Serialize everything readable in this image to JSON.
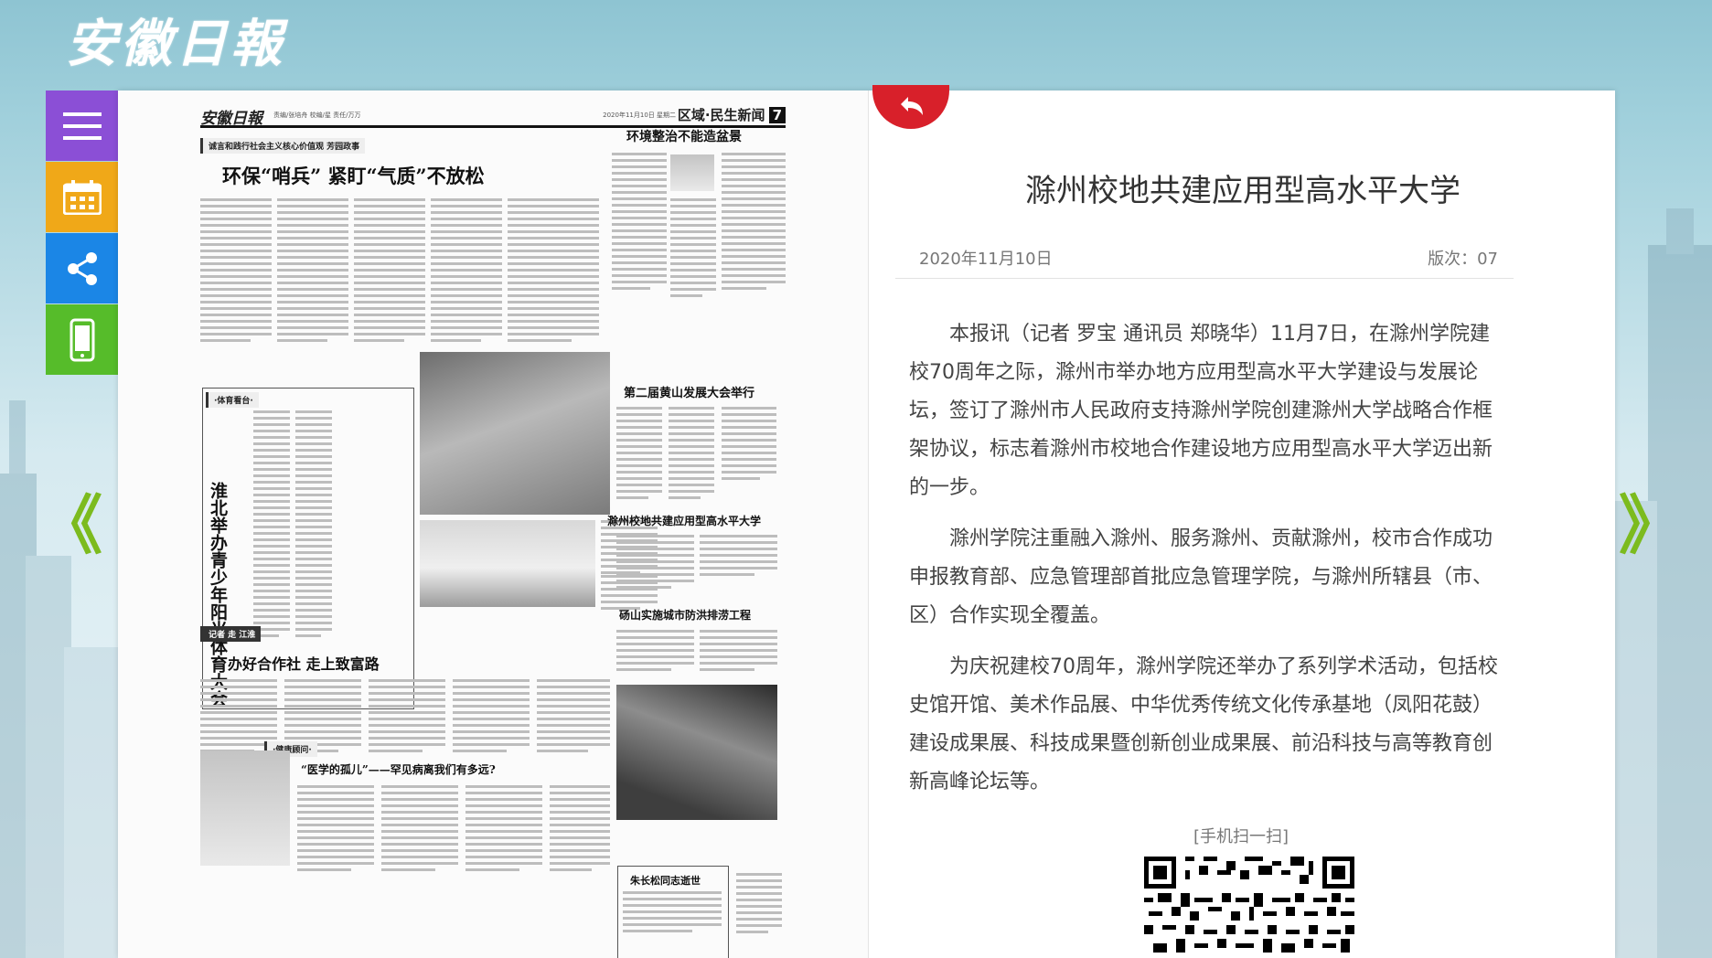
{
  "site": {
    "logo_text": "安徽日報"
  },
  "toolbar": {
    "items": [
      "menu-icon",
      "calendar-icon",
      "share-icon",
      "mobile-icon"
    ]
  },
  "nav": {
    "prev": "《",
    "next": "》"
  },
  "paper": {
    "brand": "安徽日報",
    "meta": "责编/张培舟  校编/星  责任/万万",
    "date": "2020年11月10日 星期二",
    "section": "区域·民生新闻",
    "page_no": "7",
    "kicker_top": "诚言和践行社会主义核心价值观 芳园政事",
    "headline_main": "环保“哨兵”  紧盯“气质”不放松",
    "headline_env": "环境整治不能造盆景",
    "kicker_sports": "·体育看台·",
    "vertical_title": "淮北举办青少年阳光体育大会",
    "headline_huangshan": "第二届黄山发展大会举行",
    "headline_chuzhou": "滁州校地共建应用型高水平大学",
    "kicker_reporter": "记者 走 江淮",
    "headline_coop": "办好合作社  走上致富路",
    "headline_dangshan": "砀山实施城市防洪排涝工程",
    "kicker_health": "·健康顾问·",
    "headline_health": "“医学的孤儿”——罕见病离我们有多远?",
    "headline_obit": "朱长松同志逝世"
  },
  "article": {
    "title": "滁州校地共建应用型高水平大学",
    "date": "2020年11月10日",
    "edition": "版次：07",
    "paragraphs": [
      "本报讯（记者 罗宝 通讯员 郑晓华）11月7日，在滁州学院建校70周年之际，滁州市举办地方应用型高水平大学建设与发展论坛，签订了滁州市人民政府支持滁州学院创建滁州大学战略合作框架协议，标志着滁州市校地合作建设地方应用型高水平大学迈出新的一步。",
      "滁州学院注重融入滁州、服务滁州、贡献滁州，校市合作成功申报教育部、应急管理部首批应急管理学院，与滁州所辖县（市、区）合作实现全覆盖。",
      "为庆祝建校70周年，滁州学院还举办了系列学术活动，包括校史馆开馆、美术作品展、中华优秀传统文化传承基地（凤阳花鼓）建设成果展、科技成果暨创新创业成果展、前沿科技与高等教育创新高峰论坛等。"
    ],
    "qr_label": "[手机扫一扫]"
  },
  "colors": {
    "menu": "#8b4fd6",
    "calendar": "#f0a818",
    "share": "#1b86e6",
    "mobile": "#56bc2a",
    "back": "#d8202a",
    "arrow": "#7cbb1e"
  }
}
